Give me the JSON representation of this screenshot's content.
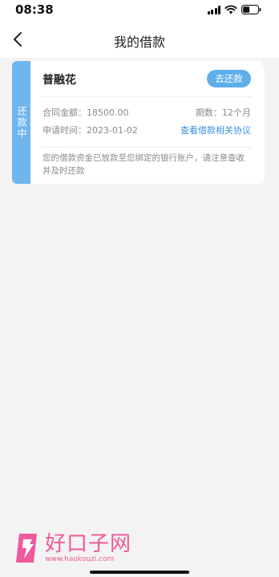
{
  "status_bar": {
    "time": "08:38"
  },
  "nav": {
    "title": "我的借款"
  },
  "loan": {
    "status_tag": "还款中",
    "product_name": "普融花",
    "repay_button": "去还款",
    "amount_text": "合同金额：18500.00",
    "periods_text": "期数：12个月",
    "apply_time_text": "申请时间：2023-01-02",
    "agreement_link": "查看借款相关协议",
    "note": "您的借款资金已放款至您绑定的银行账户，请注意查收并及时还款"
  },
  "watermark": {
    "brand": "好口子网",
    "url": "www.haokouzi.com"
  },
  "colors": {
    "accent": "#5eaee9",
    "tag": "#6fb6ee",
    "link": "#3a8fe0",
    "watermark": "#ee5a9b"
  }
}
